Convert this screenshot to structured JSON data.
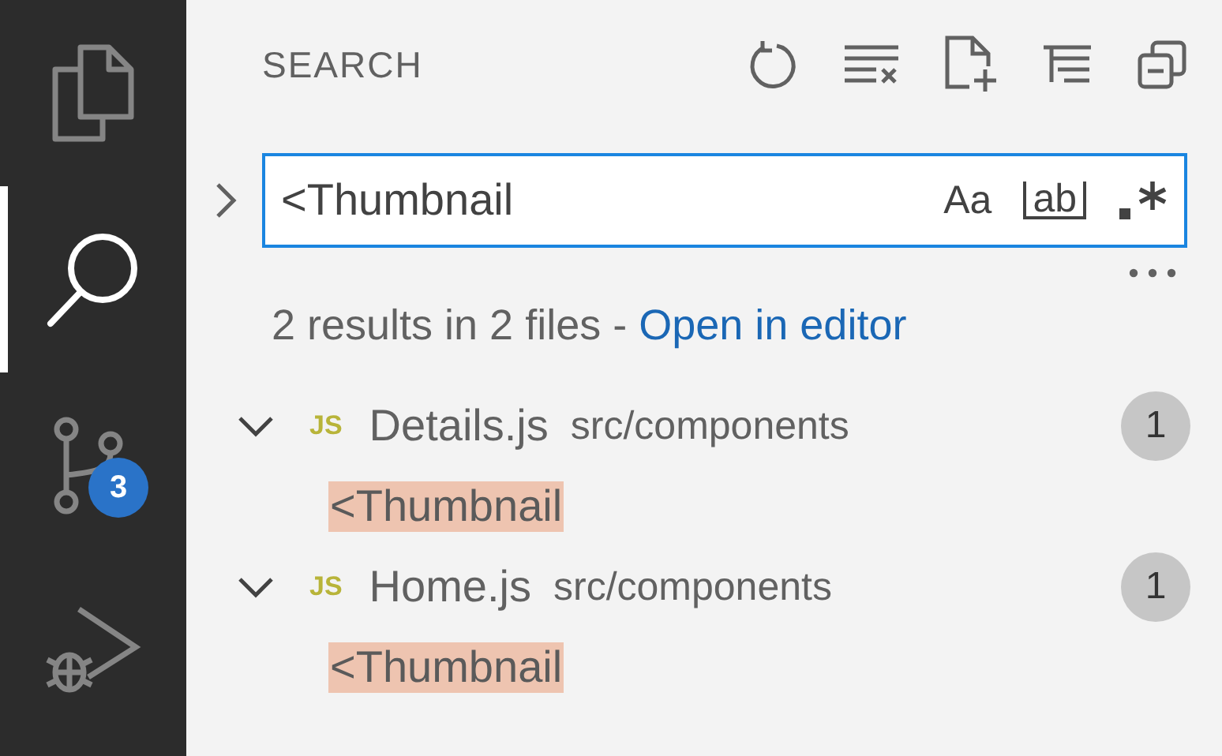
{
  "activity_bar": [
    {
      "kind": "files",
      "selected": false
    },
    {
      "kind": "search",
      "selected": true
    },
    {
      "kind": "source-control",
      "selected": false,
      "badge": "3"
    },
    {
      "kind": "run-debug",
      "selected": false
    }
  ],
  "panel": {
    "title": "SEARCH"
  },
  "search": {
    "value": "<Thumbnail",
    "options": [
      "Aa",
      "ab"
    ],
    "expanded": false
  },
  "summary": {
    "text": "2 results in 2 files - ",
    "link": "Open in editor"
  },
  "results": [
    {
      "file_type": "JS",
      "name": "Details.js",
      "path": "src/components",
      "count": "1",
      "expanded": true,
      "matches": [
        "<Thumbnail"
      ]
    },
    {
      "file_type": "JS",
      "name": "Home.js",
      "path": "src/components",
      "count": "1",
      "expanded": true,
      "matches": [
        "<Thumbnail"
      ]
    }
  ]
}
